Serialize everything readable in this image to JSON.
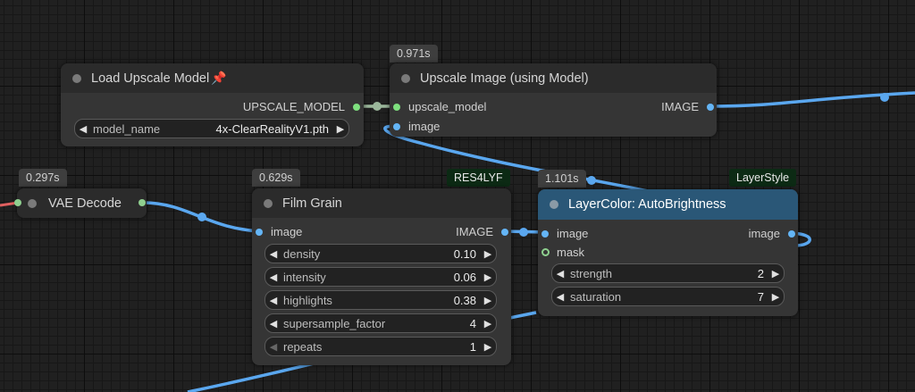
{
  "badges": {
    "upscale_time": "0.971s",
    "vae_time": "0.297s",
    "film_time": "0.629s",
    "layer_time": "1.101s"
  },
  "tags": {
    "film_pack": "RES4LYF",
    "layer_pack": "LayerStyle"
  },
  "load_upscale": {
    "title": "Load Upscale Model",
    "pin_icon": "📌",
    "output": "UPSCALE_MODEL",
    "widget_label": "model_name",
    "widget_value": "4x-ClearRealityV1.pth"
  },
  "upscale_image": {
    "title": "Upscale Image (using Model)",
    "input_model": "upscale_model",
    "input_image": "image",
    "output": "IMAGE"
  },
  "vae_decode": {
    "title": "VAE Decode"
  },
  "film_grain": {
    "title": "Film Grain",
    "input_image": "image",
    "output": "IMAGE",
    "widgets": [
      {
        "label": "density",
        "value": "0.10"
      },
      {
        "label": "intensity",
        "value": "0.06"
      },
      {
        "label": "highlights",
        "value": "0.38"
      },
      {
        "label": "supersample_factor",
        "value": "4"
      },
      {
        "label": "repeats",
        "value": "1"
      }
    ]
  },
  "layer_color": {
    "title": "LayerColor: AutoBrightness",
    "input_image": "image",
    "input_mask": "mask",
    "output": "image",
    "widgets": [
      {
        "label": "strength",
        "value": "2"
      },
      {
        "label": "saturation",
        "value": "7"
      }
    ]
  },
  "colors": {
    "image_wire": "#5aa7ef",
    "upscale_model_wire": "#9bb79b",
    "title_accent": "#2a5777"
  }
}
